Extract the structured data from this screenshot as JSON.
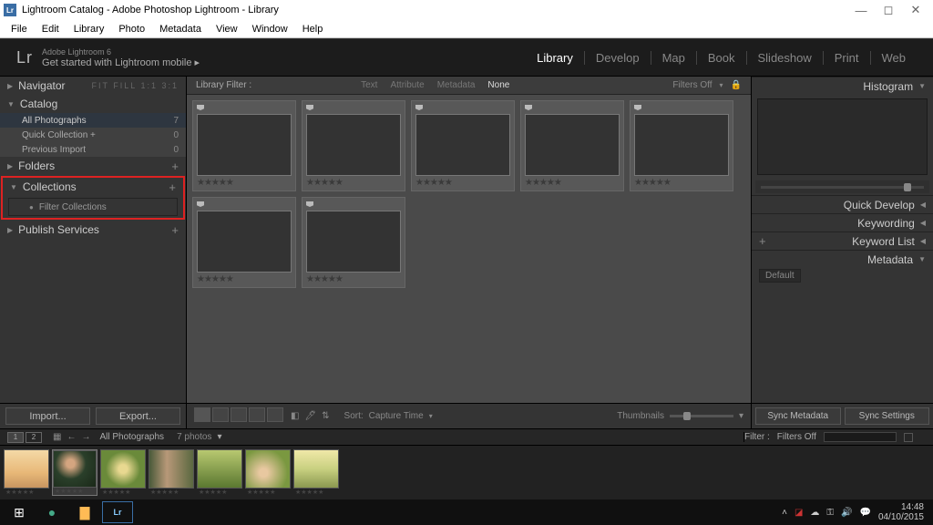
{
  "titlebar": {
    "text": "Lightroom Catalog - Adobe Photoshop Lightroom - Library"
  },
  "menubar": [
    "File",
    "Edit",
    "Library",
    "Photo",
    "Metadata",
    "View",
    "Window",
    "Help"
  ],
  "header": {
    "logo": "Lr",
    "line1": "Adobe Lightroom 6",
    "line2": "Get started with Lightroom mobile  ▸"
  },
  "modules": [
    "Library",
    "Develop",
    "Map",
    "Book",
    "Slideshow",
    "Print",
    "Web"
  ],
  "active_module": "Library",
  "left": {
    "navigator": {
      "label": "Navigator",
      "opts": "FIT  FILL  1:1  3:1"
    },
    "catalog": {
      "label": "Catalog",
      "items": [
        {
          "name": "All Photographs",
          "count": "7",
          "sel": true
        },
        {
          "name": "Quick Collection  +",
          "count": "0"
        },
        {
          "name": "Previous Import",
          "count": "0"
        }
      ]
    },
    "folders": {
      "label": "Folders"
    },
    "collections": {
      "label": "Collections",
      "filter_placeholder": "Filter Collections"
    },
    "publish": {
      "label": "Publish Services"
    },
    "buttons": {
      "import": "Import...",
      "export": "Export..."
    }
  },
  "libfilter": {
    "label": "Library Filter :",
    "opts": [
      "Text",
      "Attribute",
      "Metadata",
      "None"
    ],
    "active": "None",
    "filters_off": "Filters Off"
  },
  "grid": [
    {
      "cls": "th-paris"
    },
    {
      "cls": "th-port1"
    },
    {
      "cls": "th-swing"
    },
    {
      "cls": "th-port2"
    },
    {
      "cls": "th-basket"
    },
    {
      "cls": "th-child"
    },
    {
      "cls": "th-horse"
    }
  ],
  "ctoolbar": {
    "sort_label": "Sort:",
    "sort_val": "Capture Time",
    "thumbs": "Thumbnails"
  },
  "right": {
    "histogram": "Histogram",
    "quickdev": "Quick Develop",
    "keywording": "Keywording",
    "keywordlist": "Keyword List",
    "metadata": "Metadata",
    "meta_preset": "Default",
    "buttons": {
      "sync_meta": "Sync Metadata",
      "sync_set": "Sync Settings"
    }
  },
  "fsheader": {
    "bc1": "All Photographs",
    "bc2": "7 photos",
    "filter_lbl": "Filter :",
    "filter_val": "Filters Off"
  },
  "filmstrip": [
    {
      "cls": "th-paris"
    },
    {
      "cls": "th-port1",
      "sel": true
    },
    {
      "cls": "th-swing"
    },
    {
      "cls": "th-port2"
    },
    {
      "cls": "th-basket"
    },
    {
      "cls": "th-child"
    },
    {
      "cls": "th-horse"
    }
  ],
  "taskbar": {
    "time": "14:48",
    "date": "04/10/2015"
  }
}
